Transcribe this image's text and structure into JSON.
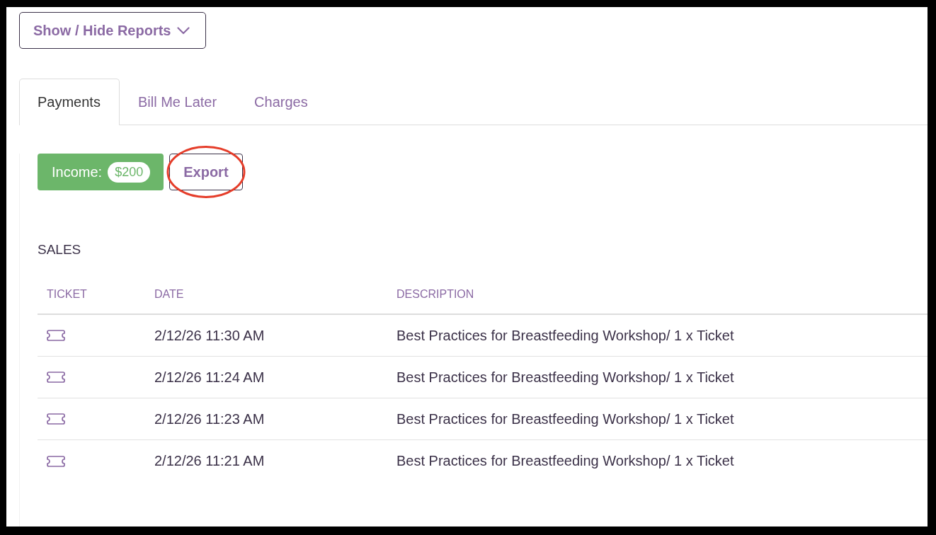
{
  "reports_toggle": {
    "label": "Show / Hide Reports"
  },
  "tabs": [
    {
      "label": "Payments",
      "selected": true
    },
    {
      "label": "Bill Me Later",
      "selected": false
    },
    {
      "label": "Charges",
      "selected": false
    }
  ],
  "income": {
    "label": "Income:",
    "amount": "$200"
  },
  "export_button": {
    "label": "Export",
    "highlighted": true
  },
  "sales": {
    "title": "SALES",
    "columns": [
      "TICKET",
      "DATE",
      "DESCRIPTION"
    ],
    "rows": [
      {
        "date": "2/12/26 11:30 AM",
        "description": "Best Practices for Breastfeeding Workshop/ 1 x Ticket"
      },
      {
        "date": "2/12/26 11:24 AM",
        "description": "Best Practices for Breastfeeding Workshop/ 1 x Ticket"
      },
      {
        "date": "2/12/26 11:23 AM",
        "description": "Best Practices for Breastfeeding Workshop/ 1 x Ticket"
      },
      {
        "date": "2/12/26 11:21 AM",
        "description": "Best Practices for Breastfeeding Workshop/ 1 x Ticket"
      }
    ]
  }
}
